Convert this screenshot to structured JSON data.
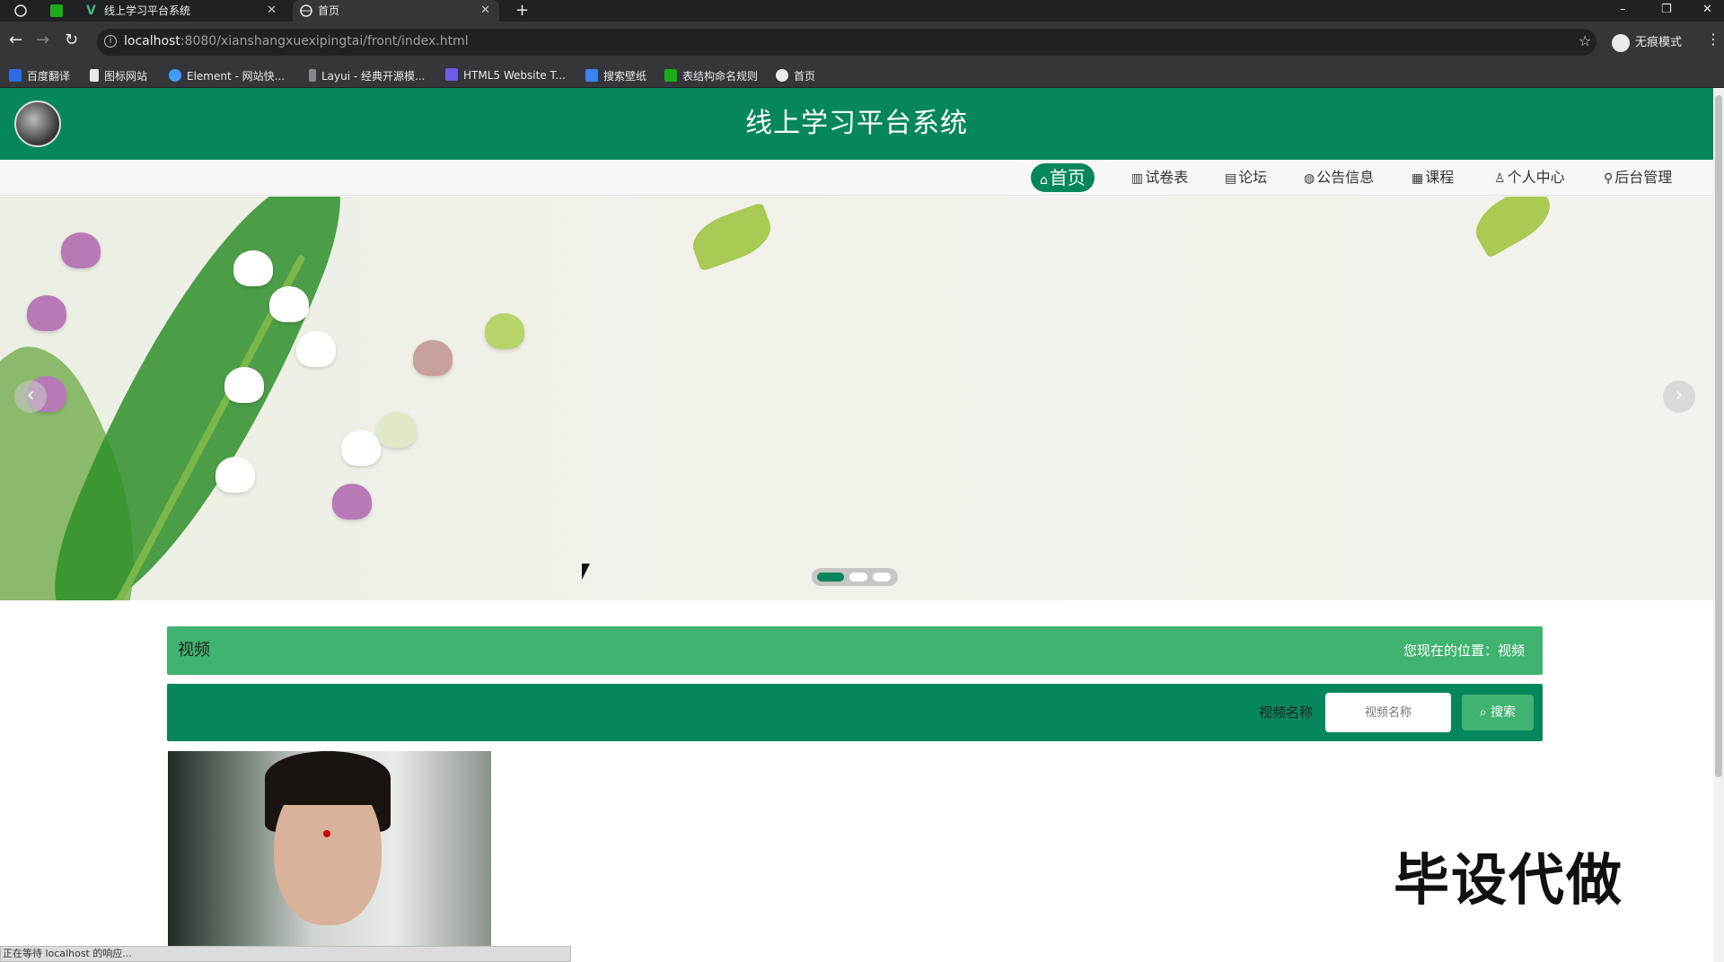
{
  "browser": {
    "tabs": [
      {
        "label": "线上学习平台系统"
      },
      {
        "label": "首页"
      }
    ],
    "new_tab": "+",
    "window_controls": {
      "minimize": "–",
      "restore": "❐",
      "close": "✕"
    },
    "url": {
      "host": "localhost",
      "path": ":8080/xianshangxuexipingtai/front/index.html"
    },
    "incognito_label": "无痕模式",
    "bookmarks": [
      {
        "label": "百度翻译",
        "color": "#2b6de6"
      },
      {
        "label": "图标网站",
        "color": "#e8eaed"
      },
      {
        "label": "Element - 网站快...",
        "color": "#409eff"
      },
      {
        "label": "Layui - 经典开源模...",
        "color": "#e8eaed"
      },
      {
        "label": "HTML5 Website T...",
        "color": "#6c5ce7"
      },
      {
        "label": "搜索壁纸",
        "color": "#3b82f6"
      },
      {
        "label": "表结构命名规则",
        "color": "#1aad19"
      },
      {
        "label": "首页",
        "color": "#e8eaed"
      }
    ]
  },
  "site": {
    "title": "线上学习平台系统",
    "brand_color": "#05865c",
    "accent_color": "#3fb36f"
  },
  "nav": {
    "items": [
      {
        "icon": "⌂",
        "label": "首页",
        "active": true
      },
      {
        "icon": "▥",
        "label": "试卷表"
      },
      {
        "icon": "▤",
        "label": "论坛"
      },
      {
        "icon": "◍",
        "label": "公告信息"
      },
      {
        "icon": "▦",
        "label": "课程"
      },
      {
        "icon": "♙",
        "label": "个人中心"
      },
      {
        "icon": "⚲",
        "label": "后台管理"
      }
    ]
  },
  "carousel": {
    "prev": "‹",
    "next": "›",
    "active_index": 0,
    "count": 3
  },
  "section": {
    "title": "视频",
    "location": "您现在的位置：视频"
  },
  "search": {
    "label": "视频名称",
    "placeholder": "视频名称",
    "button": "搜索",
    "button_icon": "⌕"
  },
  "watermark": "毕设代做",
  "status_bar": "正在等待 localhost 的响应..."
}
